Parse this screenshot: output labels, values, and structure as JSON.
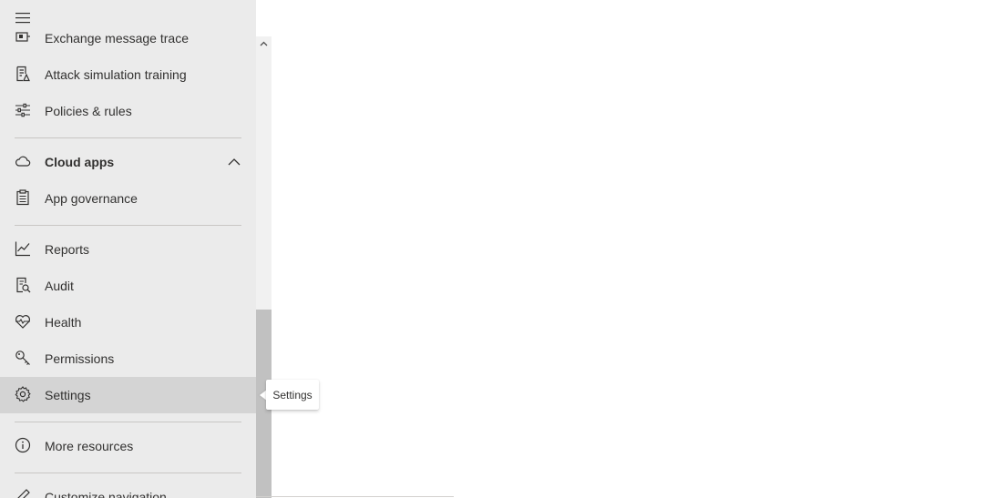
{
  "sidebar": {
    "items": [
      {
        "label": "Exchange message trace",
        "icon": "message-trace-icon"
      },
      {
        "label": "Attack simulation training",
        "icon": "attack-simulation-icon"
      },
      {
        "label": "Policies & rules",
        "icon": "policies-sliders-icon"
      },
      {
        "label": "Cloud apps",
        "icon": "cloud-icon",
        "expanded": true
      },
      {
        "label": "App governance",
        "icon": "clipboard-icon"
      },
      {
        "label": "Reports",
        "icon": "line-chart-icon"
      },
      {
        "label": "Audit",
        "icon": "audit-search-icon"
      },
      {
        "label": "Health",
        "icon": "heart-pulse-icon"
      },
      {
        "label": "Permissions",
        "icon": "key-icon"
      },
      {
        "label": "Settings",
        "icon": "gear-icon",
        "active": true
      },
      {
        "label": "More resources",
        "icon": "info-icon"
      },
      {
        "label": "Customize navigation",
        "icon": "pencil-icon"
      }
    ]
  },
  "tooltip": {
    "text": "Settings"
  },
  "colors": {
    "sidebar_bg": "#ebebeb",
    "active_bg": "#d4d4d4",
    "text": "#323130",
    "scroll_thumb": "#c1c1c1"
  }
}
